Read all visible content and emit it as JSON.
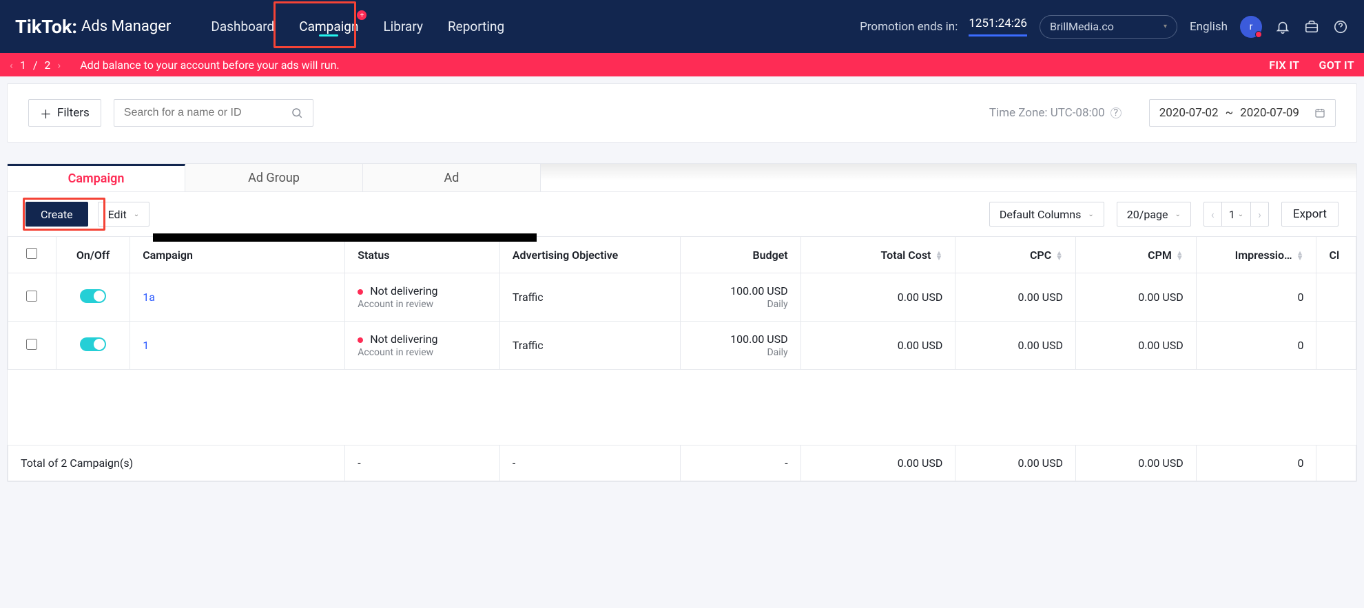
{
  "brand": {
    "name": "TikTok",
    "suffix": "Ads Manager"
  },
  "nav": {
    "items": [
      "Dashboard",
      "Campaign",
      "Library",
      "Reporting"
    ],
    "active_index": 1
  },
  "promo": {
    "label": "Promotion ends in:",
    "countdown": "1251:24:26"
  },
  "account": {
    "selected": "BrillMedia.co"
  },
  "language": "English",
  "avatar_letter": "r",
  "alert": {
    "page_current": "1",
    "page_total": "2",
    "message": "Add balance to your account before your ads will run.",
    "fix": "FIX IT",
    "got": "GOT IT"
  },
  "filters": {
    "button": "Filters",
    "search_placeholder": "Search for a name or ID",
    "timezone": "Time Zone: UTC-08:00",
    "date_from": "2020-07-02",
    "date_to": "2020-07-09",
    "date_sep": "~"
  },
  "tabs": {
    "items": [
      "Campaign",
      "Ad Group",
      "Ad"
    ],
    "active_index": 0
  },
  "toolbar": {
    "create": "Create",
    "edit": "Edit",
    "columns": "Default Columns",
    "page_size": "20/page",
    "page_num": "1",
    "export": "Export"
  },
  "table": {
    "headers": {
      "onoff": "On/Off",
      "campaign": "Campaign",
      "status": "Status",
      "objective": "Advertising Objective",
      "budget": "Budget",
      "total_cost": "Total Cost",
      "cpc": "CPC",
      "cpm": "CPM",
      "impressions": "Impressio…",
      "last": "Cl"
    },
    "rows": [
      {
        "name": "1a",
        "status_main": "Not delivering",
        "status_sub": "Account in review",
        "objective": "Traffic",
        "budget_main": "100.00 USD",
        "budget_sub": "Daily",
        "total_cost": "0.00 USD",
        "cpc": "0.00 USD",
        "cpm": "0.00 USD",
        "impressions": "0"
      },
      {
        "name": "1",
        "status_main": "Not delivering",
        "status_sub": "Account in review",
        "objective": "Traffic",
        "budget_main": "100.00 USD",
        "budget_sub": "Daily",
        "total_cost": "0.00 USD",
        "cpc": "0.00 USD",
        "cpm": "0.00 USD",
        "impressions": "0"
      }
    ],
    "footer": {
      "label": "Total of 2 Campaign(s)",
      "dash": "-",
      "total_cost": "0.00 USD",
      "cpc": "0.00 USD",
      "cpm": "0.00 USD",
      "impressions": "0"
    }
  }
}
